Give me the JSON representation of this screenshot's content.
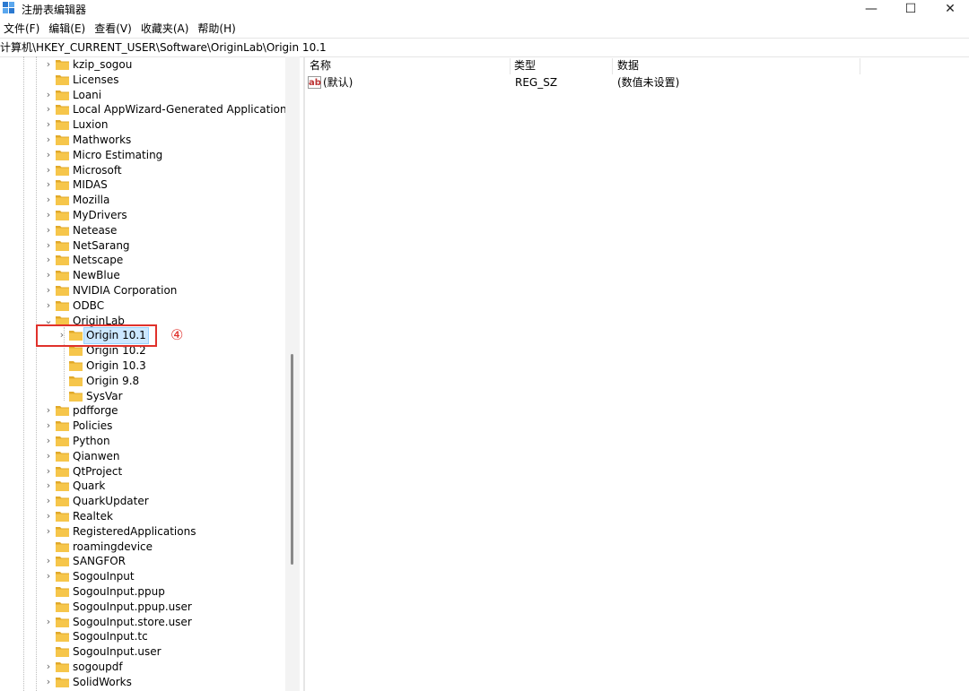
{
  "window": {
    "title": "注册表编辑器",
    "minimize": "—",
    "maximize": "☐",
    "close": "✕"
  },
  "menu": [
    "文件(F)",
    "编辑(E)",
    "查看(V)",
    "收藏夹(A)",
    "帮助(H)"
  ],
  "address": "计算机\\HKEY_CURRENT_USER\\Software\\OriginLab\\Origin 10.1",
  "tree": [
    {
      "label": "kzip_sogou",
      "expander": "›",
      "level": 0
    },
    {
      "label": "Licenses",
      "expander": "",
      "level": 0
    },
    {
      "label": "Loani",
      "expander": "›",
      "level": 0
    },
    {
      "label": "Local AppWizard-Generated Applications",
      "expander": "›",
      "level": 0
    },
    {
      "label": "Luxion",
      "expander": "›",
      "level": 0
    },
    {
      "label": "Mathworks",
      "expander": "›",
      "level": 0
    },
    {
      "label": "Micro Estimating",
      "expander": "›",
      "level": 0
    },
    {
      "label": "Microsoft",
      "expander": "›",
      "level": 0
    },
    {
      "label": "MIDAS",
      "expander": "›",
      "level": 0
    },
    {
      "label": "Mozilla",
      "expander": "›",
      "level": 0
    },
    {
      "label": "MyDrivers",
      "expander": "›",
      "level": 0
    },
    {
      "label": "Netease",
      "expander": "›",
      "level": 0
    },
    {
      "label": "NetSarang",
      "expander": "›",
      "level": 0
    },
    {
      "label": "Netscape",
      "expander": "›",
      "level": 0
    },
    {
      "label": "NewBlue",
      "expander": "›",
      "level": 0
    },
    {
      "label": "NVIDIA Corporation",
      "expander": "›",
      "level": 0
    },
    {
      "label": "ODBC",
      "expander": "›",
      "level": 0
    },
    {
      "label": "OriginLab",
      "expander": "⌄",
      "level": 0
    },
    {
      "label": "Origin 10.1",
      "expander": "›",
      "level": 1,
      "selected": true
    },
    {
      "label": "Origin 10.2",
      "expander": "",
      "level": 1
    },
    {
      "label": "Origin 10.3",
      "expander": "",
      "level": 1
    },
    {
      "label": "Origin 9.8",
      "expander": "",
      "level": 1
    },
    {
      "label": "SysVar",
      "expander": "",
      "level": 1
    },
    {
      "label": "pdfforge",
      "expander": "›",
      "level": 0
    },
    {
      "label": "Policies",
      "expander": "›",
      "level": 0
    },
    {
      "label": "Python",
      "expander": "›",
      "level": 0
    },
    {
      "label": "Qianwen",
      "expander": "›",
      "level": 0
    },
    {
      "label": "QtProject",
      "expander": "›",
      "level": 0
    },
    {
      "label": "Quark",
      "expander": "›",
      "level": 0
    },
    {
      "label": "QuarkUpdater",
      "expander": "›",
      "level": 0
    },
    {
      "label": "Realtek",
      "expander": "›",
      "level": 0
    },
    {
      "label": "RegisteredApplications",
      "expander": "›",
      "level": 0
    },
    {
      "label": "roamingdevice",
      "expander": "",
      "level": 0
    },
    {
      "label": "SANGFOR",
      "expander": "›",
      "level": 0
    },
    {
      "label": "SogouInput",
      "expander": "›",
      "level": 0
    },
    {
      "label": "SogouInput.ppup",
      "expander": "",
      "level": 0
    },
    {
      "label": "SogouInput.ppup.user",
      "expander": "",
      "level": 0
    },
    {
      "label": "SogouInput.store.user",
      "expander": "›",
      "level": 0
    },
    {
      "label": "SogouInput.tc",
      "expander": "",
      "level": 0
    },
    {
      "label": "SogouInput.user",
      "expander": "",
      "level": 0
    },
    {
      "label": "sogoupdf",
      "expander": "›",
      "level": 0
    },
    {
      "label": "SolidWorks",
      "expander": "›",
      "level": 0
    }
  ],
  "annotation": "④",
  "columns": {
    "name": "名称",
    "type": "类型",
    "data": "数据"
  },
  "values": [
    {
      "name": "(默认)",
      "type": "REG_SZ",
      "data": "(数值未设置)",
      "icon": "ab"
    }
  ],
  "colors": {
    "folder": "#f6c64b",
    "folder_dark": "#e1a92a",
    "selection": "#cce8ff",
    "annotation": "#e0312b"
  }
}
